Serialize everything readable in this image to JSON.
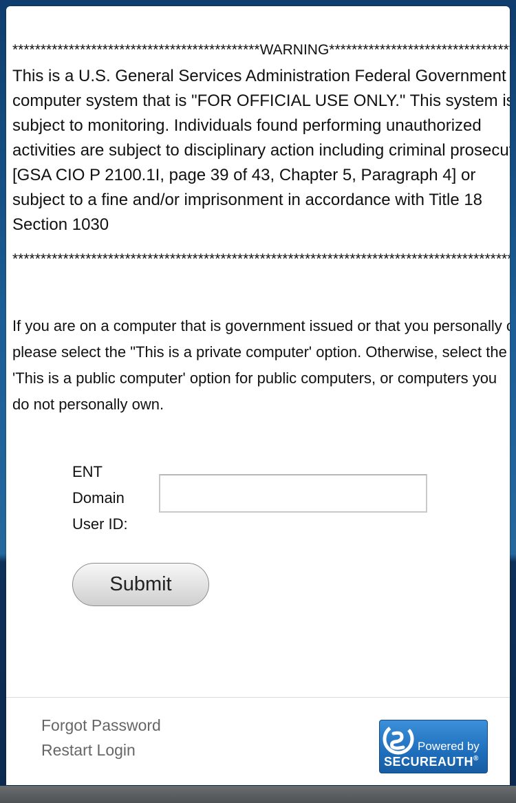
{
  "warning": {
    "stars_top": "********************************************WARNING********************************************",
    "lines": [
      "This is a U.S. General Services Administration Federal Government",
      "computer system that is \"FOR OFFICIAL USE ONLY.\" This system is",
      "subject to monitoring. Individuals found performing unauthorized",
      "activities are subject to disciplinary action including criminal prosecution",
      "[GSA CIO P 2100.1I, page 39 of 43, Chapter 5, Paragraph 4] or",
      "subject to a fine and/or imprisonment in accordance with Title 18",
      "Section 1030"
    ],
    "stars_bottom": "*************************************************************************************************************"
  },
  "instructions": {
    "lines": [
      "If you are on a computer that is government issued or that you personally own,",
      "please select the \"This is a private computer' option. Otherwise, select the",
      "'This is a public computer' option for public computers, or computers you",
      "do not personally own."
    ]
  },
  "login_form": {
    "label_lines": [
      "ENT",
      "Domain",
      "User ID:"
    ],
    "user_id_value": "",
    "submit_label": "Submit"
  },
  "footer": {
    "links": [
      "Forgot Password",
      "Restart Login"
    ],
    "badge": {
      "powered_text": "Powered by",
      "brand_text": "SECUREAUTH",
      "trademark": "®"
    }
  },
  "colors": {
    "background_blue": "#1b5e96",
    "link_gray": "#666666",
    "badge_blue": "#1f6fbd"
  }
}
